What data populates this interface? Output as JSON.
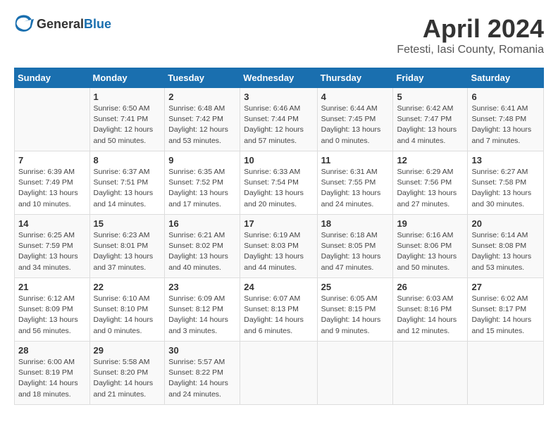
{
  "header": {
    "logo_general": "General",
    "logo_blue": "Blue",
    "title": "April 2024",
    "subtitle": "Fetesti, Iasi County, Romania"
  },
  "calendar": {
    "weekdays": [
      "Sunday",
      "Monday",
      "Tuesday",
      "Wednesday",
      "Thursday",
      "Friday",
      "Saturday"
    ],
    "weeks": [
      [
        {
          "day": "",
          "info": ""
        },
        {
          "day": "1",
          "info": "Sunrise: 6:50 AM\nSunset: 7:41 PM\nDaylight: 12 hours\nand 50 minutes."
        },
        {
          "day": "2",
          "info": "Sunrise: 6:48 AM\nSunset: 7:42 PM\nDaylight: 12 hours\nand 53 minutes."
        },
        {
          "day": "3",
          "info": "Sunrise: 6:46 AM\nSunset: 7:44 PM\nDaylight: 12 hours\nand 57 minutes."
        },
        {
          "day": "4",
          "info": "Sunrise: 6:44 AM\nSunset: 7:45 PM\nDaylight: 13 hours\nand 0 minutes."
        },
        {
          "day": "5",
          "info": "Sunrise: 6:42 AM\nSunset: 7:47 PM\nDaylight: 13 hours\nand 4 minutes."
        },
        {
          "day": "6",
          "info": "Sunrise: 6:41 AM\nSunset: 7:48 PM\nDaylight: 13 hours\nand 7 minutes."
        }
      ],
      [
        {
          "day": "7",
          "info": "Sunrise: 6:39 AM\nSunset: 7:49 PM\nDaylight: 13 hours\nand 10 minutes."
        },
        {
          "day": "8",
          "info": "Sunrise: 6:37 AM\nSunset: 7:51 PM\nDaylight: 13 hours\nand 14 minutes."
        },
        {
          "day": "9",
          "info": "Sunrise: 6:35 AM\nSunset: 7:52 PM\nDaylight: 13 hours\nand 17 minutes."
        },
        {
          "day": "10",
          "info": "Sunrise: 6:33 AM\nSunset: 7:54 PM\nDaylight: 13 hours\nand 20 minutes."
        },
        {
          "day": "11",
          "info": "Sunrise: 6:31 AM\nSunset: 7:55 PM\nDaylight: 13 hours\nand 24 minutes."
        },
        {
          "day": "12",
          "info": "Sunrise: 6:29 AM\nSunset: 7:56 PM\nDaylight: 13 hours\nand 27 minutes."
        },
        {
          "day": "13",
          "info": "Sunrise: 6:27 AM\nSunset: 7:58 PM\nDaylight: 13 hours\nand 30 minutes."
        }
      ],
      [
        {
          "day": "14",
          "info": "Sunrise: 6:25 AM\nSunset: 7:59 PM\nDaylight: 13 hours\nand 34 minutes."
        },
        {
          "day": "15",
          "info": "Sunrise: 6:23 AM\nSunset: 8:01 PM\nDaylight: 13 hours\nand 37 minutes."
        },
        {
          "day": "16",
          "info": "Sunrise: 6:21 AM\nSunset: 8:02 PM\nDaylight: 13 hours\nand 40 minutes."
        },
        {
          "day": "17",
          "info": "Sunrise: 6:19 AM\nSunset: 8:03 PM\nDaylight: 13 hours\nand 44 minutes."
        },
        {
          "day": "18",
          "info": "Sunrise: 6:18 AM\nSunset: 8:05 PM\nDaylight: 13 hours\nand 47 minutes."
        },
        {
          "day": "19",
          "info": "Sunrise: 6:16 AM\nSunset: 8:06 PM\nDaylight: 13 hours\nand 50 minutes."
        },
        {
          "day": "20",
          "info": "Sunrise: 6:14 AM\nSunset: 8:08 PM\nDaylight: 13 hours\nand 53 minutes."
        }
      ],
      [
        {
          "day": "21",
          "info": "Sunrise: 6:12 AM\nSunset: 8:09 PM\nDaylight: 13 hours\nand 56 minutes."
        },
        {
          "day": "22",
          "info": "Sunrise: 6:10 AM\nSunset: 8:10 PM\nDaylight: 14 hours\nand 0 minutes."
        },
        {
          "day": "23",
          "info": "Sunrise: 6:09 AM\nSunset: 8:12 PM\nDaylight: 14 hours\nand 3 minutes."
        },
        {
          "day": "24",
          "info": "Sunrise: 6:07 AM\nSunset: 8:13 PM\nDaylight: 14 hours\nand 6 minutes."
        },
        {
          "day": "25",
          "info": "Sunrise: 6:05 AM\nSunset: 8:15 PM\nDaylight: 14 hours\nand 9 minutes."
        },
        {
          "day": "26",
          "info": "Sunrise: 6:03 AM\nSunset: 8:16 PM\nDaylight: 14 hours\nand 12 minutes."
        },
        {
          "day": "27",
          "info": "Sunrise: 6:02 AM\nSunset: 8:17 PM\nDaylight: 14 hours\nand 15 minutes."
        }
      ],
      [
        {
          "day": "28",
          "info": "Sunrise: 6:00 AM\nSunset: 8:19 PM\nDaylight: 14 hours\nand 18 minutes."
        },
        {
          "day": "29",
          "info": "Sunrise: 5:58 AM\nSunset: 8:20 PM\nDaylight: 14 hours\nand 21 minutes."
        },
        {
          "day": "30",
          "info": "Sunrise: 5:57 AM\nSunset: 8:22 PM\nDaylight: 14 hours\nand 24 minutes."
        },
        {
          "day": "",
          "info": ""
        },
        {
          "day": "",
          "info": ""
        },
        {
          "day": "",
          "info": ""
        },
        {
          "day": "",
          "info": ""
        }
      ]
    ]
  }
}
